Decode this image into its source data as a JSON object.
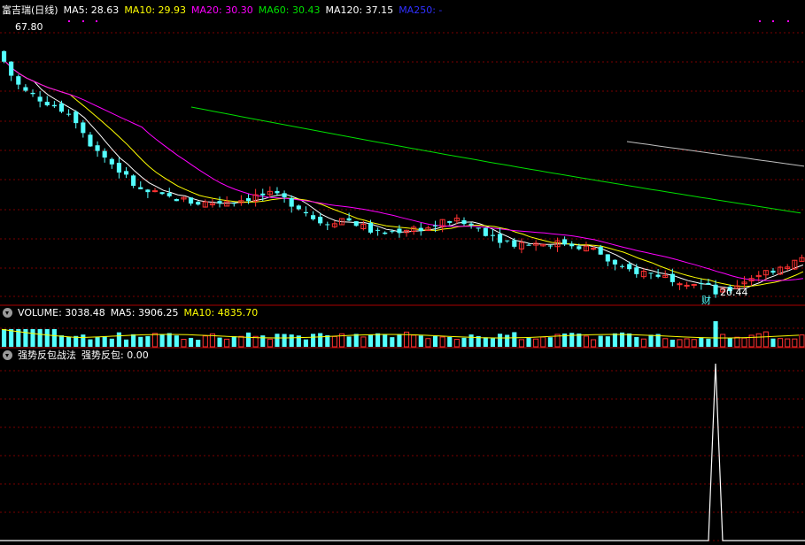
{
  "main": {
    "stock_name": "富吉瑞(日线)",
    "ma5": "MA5: 28.63",
    "ma10": "MA10: 29.93",
    "ma20": "MA20: 30.30",
    "ma60": "MA60: 30.43",
    "ma120": "MA120: 37.15",
    "ma250": "MA250: -",
    "high_label": "67.80",
    "low_label": "20.44",
    "fin_marker": "财"
  },
  "volume_panel": {
    "title": "VOLUME: 3038.48",
    "ma5": "MA5: 3906.25",
    "ma10": "MA10: 4835.70"
  },
  "indicator_panel": {
    "title": "强势反包战法",
    "value": "强势反包: 0.00"
  },
  "colors": {
    "up": "#ff3232",
    "down": "#54ffff",
    "ma5": "#ffffff",
    "ma10": "#ffff00",
    "ma20": "#ff00ff",
    "ma60": "#00e000",
    "ma120": "#c0c0c0",
    "ma250": "#3030ff",
    "grid": "#7a0000",
    "border": "#aa0000"
  },
  "chart_data": {
    "type": "candlestick",
    "price_high": 67.8,
    "price_low": 20.44,
    "close_path": [
      62,
      58,
      56,
      55,
      54,
      53,
      52,
      50,
      46,
      44,
      42,
      40,
      38,
      36,
      36,
      35,
      35,
      34.5,
      34,
      34,
      34,
      34.5,
      34.5,
      35,
      35.5,
      35.5,
      35,
      34,
      33,
      31,
      30,
      30.5,
      31,
      30,
      29,
      28,
      28,
      28.5,
      29,
      29,
      29,
      30,
      30.5,
      30,
      29.5,
      28.5,
      27.5,
      26.5,
      26,
      26,
      26,
      26,
      26,
      26,
      25.5,
      25,
      24,
      22,
      20.8,
      20.5,
      20.3,
      20,
      19.5,
      19,
      18.5,
      18.2,
      17.5,
      16,
      16.5,
      18,
      19,
      20,
      20.5,
      21.5,
      22,
      23
    ],
    "indicator_peak": 1,
    "indicator_value": 0.0
  }
}
